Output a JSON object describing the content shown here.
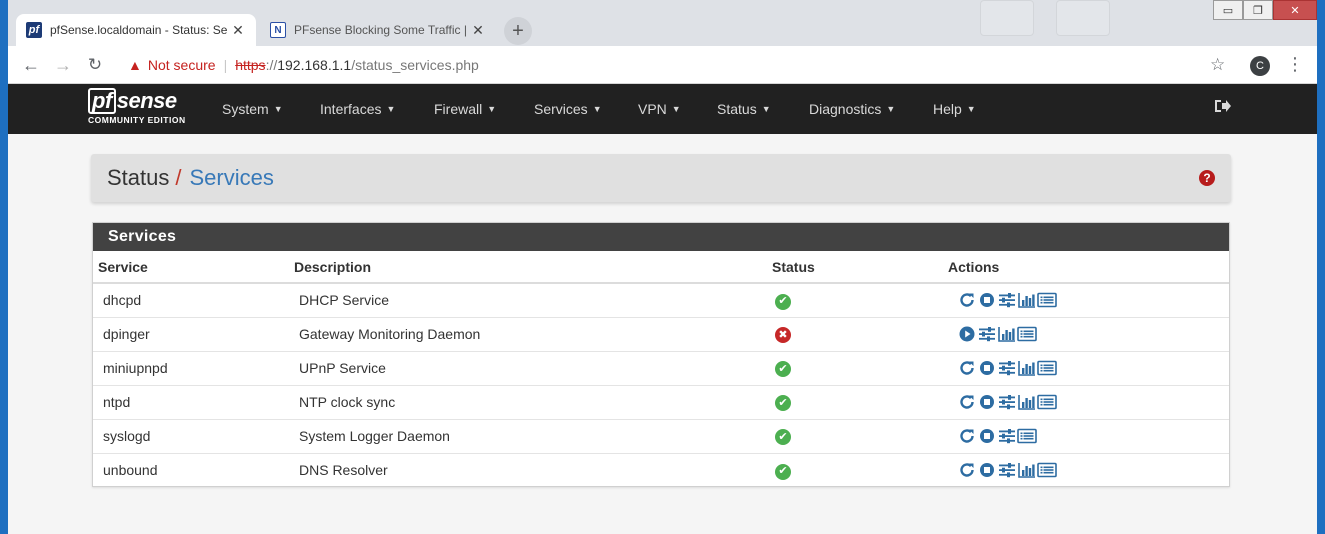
{
  "browser": {
    "tabs": [
      {
        "favicon": "pf",
        "title": "pfSense.localdomain - Status: Se",
        "active": true
      },
      {
        "favicon": "N",
        "title": "PFsense Blocking Some Traffic | N",
        "active": false
      }
    ],
    "new_tab": "+",
    "window_controls": {
      "minimize": "▭",
      "restore": "❐",
      "close": "✕"
    },
    "security_label": "Not secure",
    "url_protocol": "https",
    "url_host": "192.168.1.1",
    "url_path": "/status_services.php",
    "profile_initial": "C"
  },
  "navbar": {
    "logo_mark": "pf",
    "logo_text": "sense",
    "logo_edition": "COMMUNITY EDITION",
    "menus": [
      "System",
      "Interfaces",
      "Firewall",
      "Services",
      "VPN",
      "Status",
      "Diagnostics",
      "Help"
    ]
  },
  "breadcrumb": {
    "parent": "Status",
    "separator": "/",
    "current": "Services"
  },
  "panel": {
    "title": "Services",
    "columns": [
      "Service",
      "Description",
      "Status",
      "Actions"
    ],
    "rows": [
      {
        "service": "dhcpd",
        "description": "DHCP Service",
        "status": "running",
        "actions": [
          "restart-icon",
          "stop-icon",
          "settings-icon",
          "graph-icon",
          "log-icon"
        ]
      },
      {
        "service": "dpinger",
        "description": "Gateway Monitoring Daemon",
        "status": "stopped",
        "actions": [
          "play-icon",
          "settings-icon",
          "graph-icon",
          "log-icon"
        ]
      },
      {
        "service": "miniupnpd",
        "description": "UPnP Service",
        "status": "running",
        "actions": [
          "restart-icon",
          "stop-icon",
          "settings-icon",
          "graph-icon",
          "log-icon"
        ]
      },
      {
        "service": "ntpd",
        "description": "NTP clock sync",
        "status": "running",
        "actions": [
          "restart-icon",
          "stop-icon",
          "settings-icon",
          "graph-icon",
          "log-icon"
        ]
      },
      {
        "service": "syslogd",
        "description": "System Logger Daemon",
        "status": "running",
        "actions": [
          "restart-icon",
          "stop-icon",
          "settings-icon",
          "log-icon"
        ]
      },
      {
        "service": "unbound",
        "description": "DNS Resolver",
        "status": "running",
        "actions": [
          "restart-icon",
          "stop-icon",
          "settings-icon",
          "graph-icon",
          "log-icon"
        ]
      }
    ]
  },
  "colors": {
    "navbar": "#212121",
    "accent_blue": "#3879b8",
    "icon_blue": "#2d6ca2",
    "ok": "#4caf50",
    "error": "#c62828"
  }
}
